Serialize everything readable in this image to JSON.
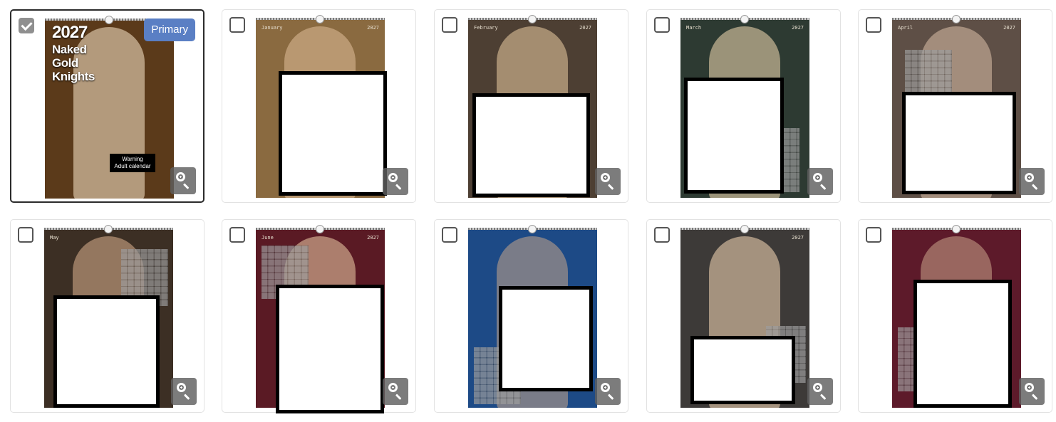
{
  "cards": [
    {
      "name": "card-cover",
      "month": "",
      "year": "",
      "primary_label": "Primary",
      "selected": true,
      "cover": {
        "year": "2027",
        "line1": "Naked",
        "line2": "Gold",
        "line3": "Knights",
        "warning1": "Warning",
        "warning2": "Adult calendar"
      },
      "bg": "#5b3a1a",
      "fig": "#d8c3a6"
    },
    {
      "name": "card-january",
      "month": "January",
      "year": "2027",
      "selected": false,
      "bg": "#8a6a40",
      "fig": "#d9b792"
    },
    {
      "name": "card-february",
      "month": "February",
      "year": "2027",
      "selected": false,
      "bg": "#4d3f33",
      "fig": "#e0c29a"
    },
    {
      "name": "card-march",
      "month": "March",
      "year": "2027",
      "selected": false,
      "bg": "#2d3a32",
      "fig": "#e5cfa8"
    },
    {
      "name": "card-april",
      "month": "April",
      "year": "2027",
      "selected": false,
      "bg": "#5e4f46",
      "fig": "#d2b8a0"
    },
    {
      "name": "card-may",
      "month": "May",
      "year": "",
      "selected": false,
      "bg": "#3c2f24",
      "fig": "#cfa987"
    },
    {
      "name": "card-june",
      "month": "June",
      "year": "2027",
      "selected": false,
      "bg": "#5a1a24",
      "fig": "#e2c29e"
    },
    {
      "name": "card-july",
      "month": "",
      "year": "",
      "selected": false,
      "bg": "#1d4a86",
      "fig": "#c7a58a"
    },
    {
      "name": "card-august",
      "month": "",
      "year": "2027",
      "selected": false,
      "bg": "#3d3a38",
      "fig": "#dcc2a4"
    },
    {
      "name": "card-september",
      "month": "",
      "year": "",
      "selected": false,
      "bg": "#5d1a2a",
      "fig": "#caa68a"
    }
  ],
  "icons": {
    "zoom": "zoom-in-icon",
    "check": "checkmark-icon",
    "hanger": "calendar-hanger-icon"
  },
  "colors": {
    "primary_badge": "#5a7fc4",
    "selected_border": "#2b2b2b",
    "zoom_bg": "#5f5f5f"
  }
}
